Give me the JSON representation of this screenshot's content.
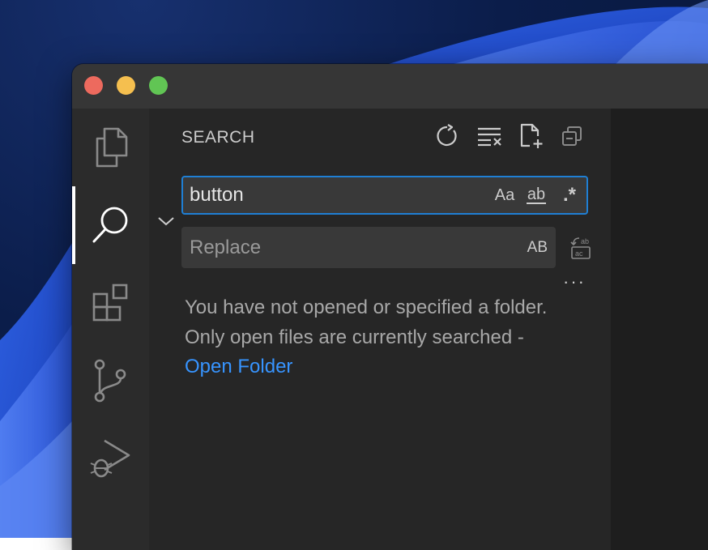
{
  "window": {
    "controls": [
      "close",
      "minimize",
      "zoom"
    ]
  },
  "activity_bar": {
    "items": [
      {
        "icon": "files-icon",
        "active": false
      },
      {
        "icon": "search-icon",
        "active": true
      },
      {
        "icon": "extensions-icon",
        "active": false
      },
      {
        "icon": "source-control-icon",
        "active": false
      },
      {
        "icon": "run-debug-icon",
        "active": false
      }
    ]
  },
  "search_panel": {
    "title": "SEARCH",
    "actions": [
      "refresh-icon",
      "clear-results-icon",
      "new-search-editor-icon",
      "collapse-all-icon"
    ],
    "search": {
      "value": "button",
      "match_case_label": "Aa",
      "whole_word_label": "ab",
      "regex_label": ".*"
    },
    "replace": {
      "value": "",
      "placeholder": "Replace",
      "preserve_case_label": "AB"
    },
    "more_label": "···",
    "message": {
      "text": "You have not opened or specified a folder. Only open files are currently searched - ",
      "link": "Open Folder"
    }
  },
  "colors": {
    "accent": "#1f7fd4",
    "link": "#3794ff",
    "sidebar_bg": "#262626",
    "activitybar_bg": "#2b2b2b",
    "titlebar_bg": "#363636"
  }
}
